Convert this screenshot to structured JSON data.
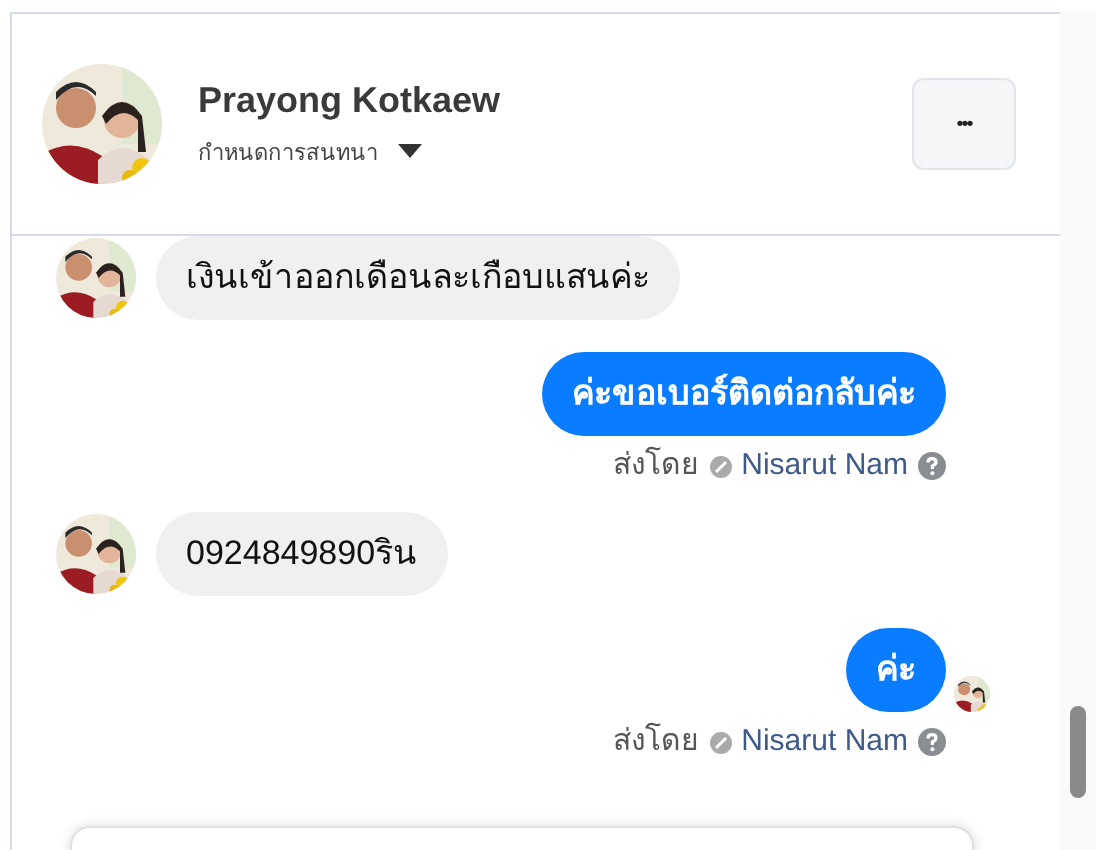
{
  "header": {
    "name": "Prayong Kotkaew",
    "subtitle": "กำหนดการสนทนา",
    "menu_button": "•••"
  },
  "messages": [
    {
      "kind": "incoming",
      "text": "เงินเข้าออกเดือนละเกือบแสนค่ะ"
    },
    {
      "kind": "outgoing",
      "text": "ค่ะขอเบอร์ติดต่อกลับค่ะ",
      "sent_by": "ส่งโดย",
      "agent": "Nisarut Nam",
      "seen": false
    },
    {
      "kind": "incoming",
      "text": "0924849890ริน"
    },
    {
      "kind": "outgoing",
      "text": "ค่ะ",
      "sent_by": "ส่งโดย",
      "agent": "Nisarut Nam",
      "seen": true
    }
  ]
}
